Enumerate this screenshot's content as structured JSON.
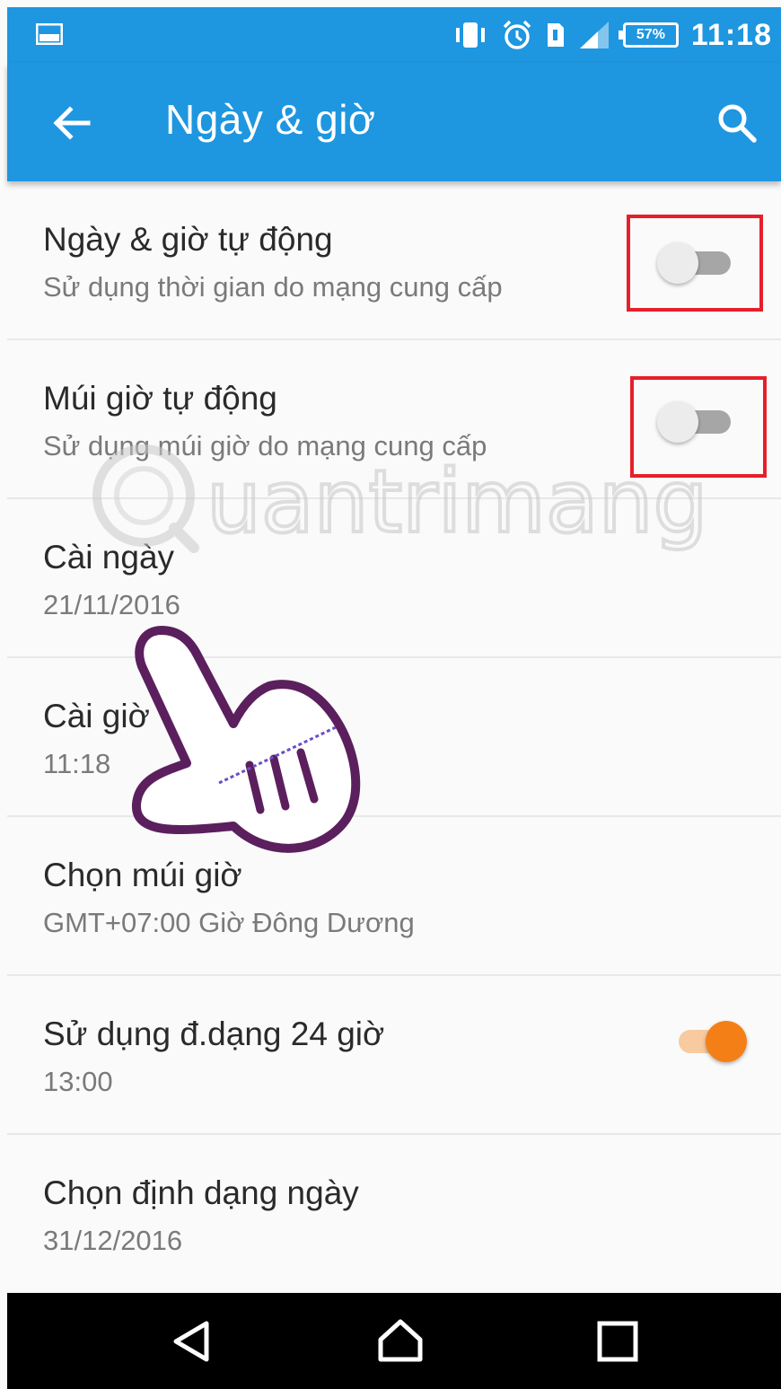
{
  "status_bar": {
    "time": "11:18",
    "battery_percent": "57%",
    "icons": [
      "image-icon",
      "vibrate-icon",
      "alarm-icon",
      "sim-icon",
      "signal-icon",
      "battery-icon"
    ]
  },
  "app_bar": {
    "title": "Ngày & giờ",
    "back_icon": "arrow-back-icon",
    "search_icon": "search-icon"
  },
  "settings": [
    {
      "title": "Ngày & giờ tự động",
      "subtitle": "Sử dụng thời gian do mạng cung cấp",
      "toggle": "off",
      "highlighted": true
    },
    {
      "title": "Múi giờ tự động",
      "subtitle": "Sử dụng múi giờ do mạng cung cấp",
      "toggle": "off",
      "highlighted": true
    },
    {
      "title": "Cài ngày",
      "subtitle": "21/11/2016"
    },
    {
      "title": "Cài giờ",
      "subtitle": "11:18"
    },
    {
      "title": "Chọn múi giờ",
      "subtitle": "GMT+07:00 Giờ Đông Dương"
    },
    {
      "title": "Sử dụng đ.dạng 24 giờ",
      "subtitle": "13:00",
      "toggle": "on"
    },
    {
      "title": "Chọn định dạng ngày",
      "subtitle": "31/12/2016"
    }
  ],
  "watermark": "Quantrimang",
  "nav_bar": {
    "back": "nav-back-icon",
    "home": "nav-home-icon",
    "recents": "nav-recents-icon"
  },
  "colors": {
    "app_bar": "#1f96e0",
    "accent": "#f57f17",
    "highlight": "#e5202a"
  }
}
